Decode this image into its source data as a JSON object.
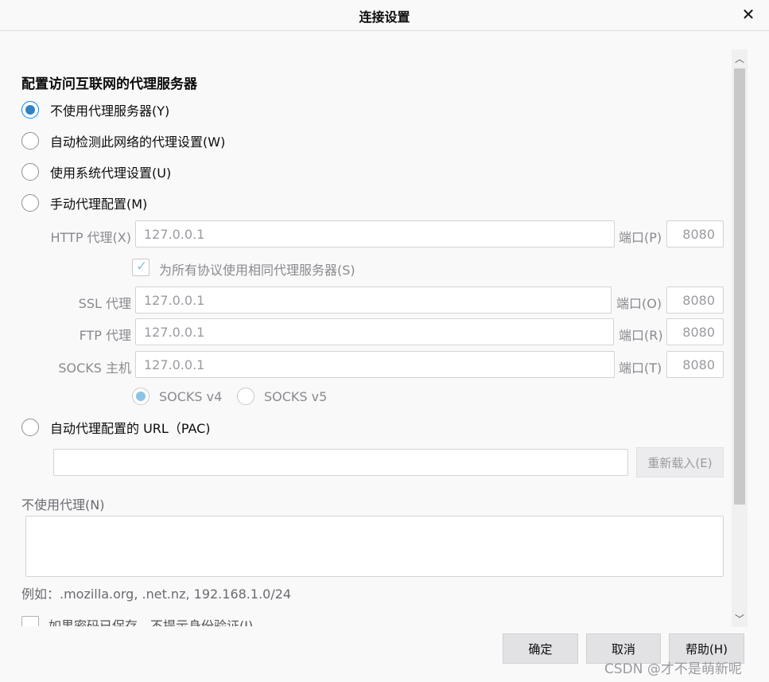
{
  "window": {
    "title": "连接设置"
  },
  "section_title": "配置访问互联网的代理服务器",
  "options": {
    "no_proxy": "不使用代理服务器(Y)",
    "auto_detect": "自动检测此网络的代理设置(W)",
    "system_proxy": "使用系统代理设置(U)",
    "manual": "手动代理配置(M)"
  },
  "http": {
    "label": "HTTP 代理(X)",
    "value": "127.0.0.1",
    "port_label": "端口(P)",
    "port": "8080"
  },
  "same_proxy": {
    "label": "为所有协议使用相同代理服务器(S)"
  },
  "ssl": {
    "label": "SSL 代理",
    "value": "127.0.0.1",
    "port_label": "端口(O)",
    "port": "8080"
  },
  "ftp": {
    "label": "FTP 代理",
    "value": "127.0.0.1",
    "port_label": "端口(R)",
    "port": "8080"
  },
  "socks": {
    "label": "SOCKS 主机",
    "value": "127.0.0.1",
    "port_label": "端口(T)",
    "port": "8080",
    "v4": "SOCKS v4",
    "v5": "SOCKS v5"
  },
  "pac": {
    "label": "自动代理配置的 URL（PAC)",
    "value": "",
    "reload": "重新载入(E)"
  },
  "no_proxy_for": {
    "label": "不使用代理(N)",
    "value": "",
    "example": "例如：.mozilla.org, .net.nz, 192.168.1.0/24"
  },
  "cut_option": "如果密码已保存，不提示身份验证(I)",
  "buttons": {
    "ok": "确定",
    "cancel": "取消",
    "help": "帮助(H)"
  },
  "watermark": "CSDN @才不是萌新呢",
  "colors": {
    "accent": "#0a84ff",
    "radio_fill": "#2d83c5"
  }
}
